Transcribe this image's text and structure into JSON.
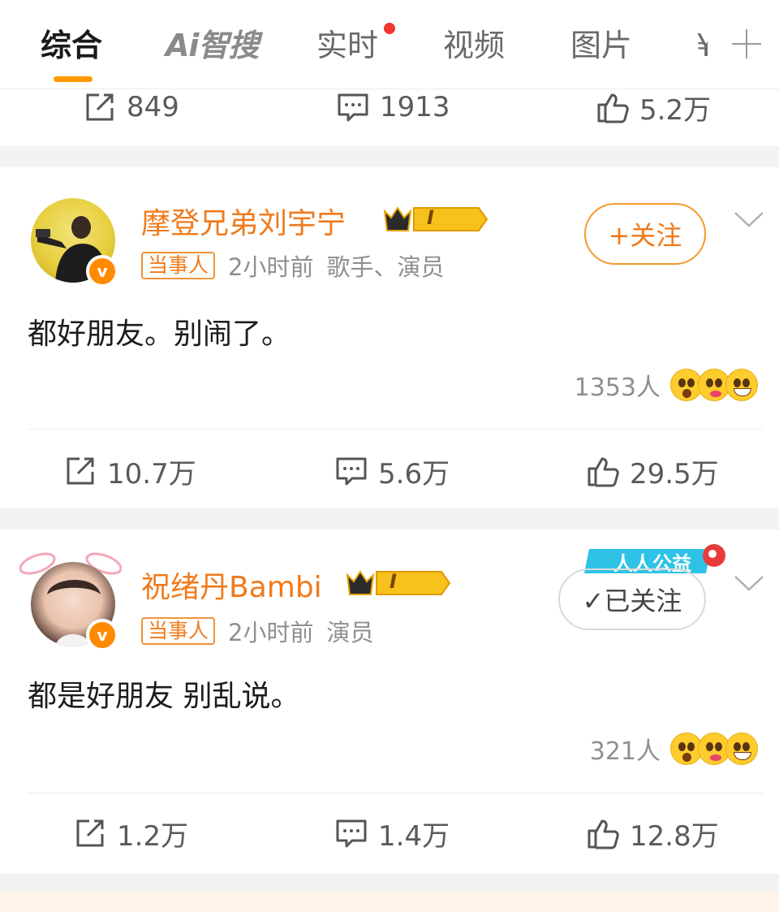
{
  "tabs": [
    {
      "label": "综合",
      "active": true
    },
    {
      "label": "Ai智搜",
      "active": false
    },
    {
      "label": "实时",
      "active": false,
      "dot": true
    },
    {
      "label": "视频",
      "active": false
    },
    {
      "label": "图片",
      "active": false
    },
    {
      "label": "¥",
      "active": false
    }
  ],
  "prev_post": {
    "repost": "849",
    "comment": "1913",
    "like": "5.2万"
  },
  "posts": [
    {
      "username": "摩登兄弟刘宇宁",
      "tag": "当事人",
      "time": "2小时前",
      "role": "歌手、演员",
      "follow_label": "+关注",
      "text": "都好朋友。别闹了。",
      "reactions": "1353人",
      "repost": "10.7万",
      "comment": "5.6万",
      "like": "29.5万"
    },
    {
      "username": "祝绪丹Bambi",
      "tag": "当事人",
      "time": "2小时前",
      "role": "演员",
      "follow_label": "✓已关注",
      "badge": "人人公益",
      "text": "都是好朋友 别乱说。",
      "reactions": "321人",
      "repost": "1.2万",
      "comment": "1.4万",
      "like": "12.8万"
    }
  ],
  "level_badge": "I",
  "colors": {
    "accent": "#ff9a00",
    "username": "#f07a1b",
    "notify_dot": "#f2342f",
    "gap": "#f2f2f2"
  }
}
